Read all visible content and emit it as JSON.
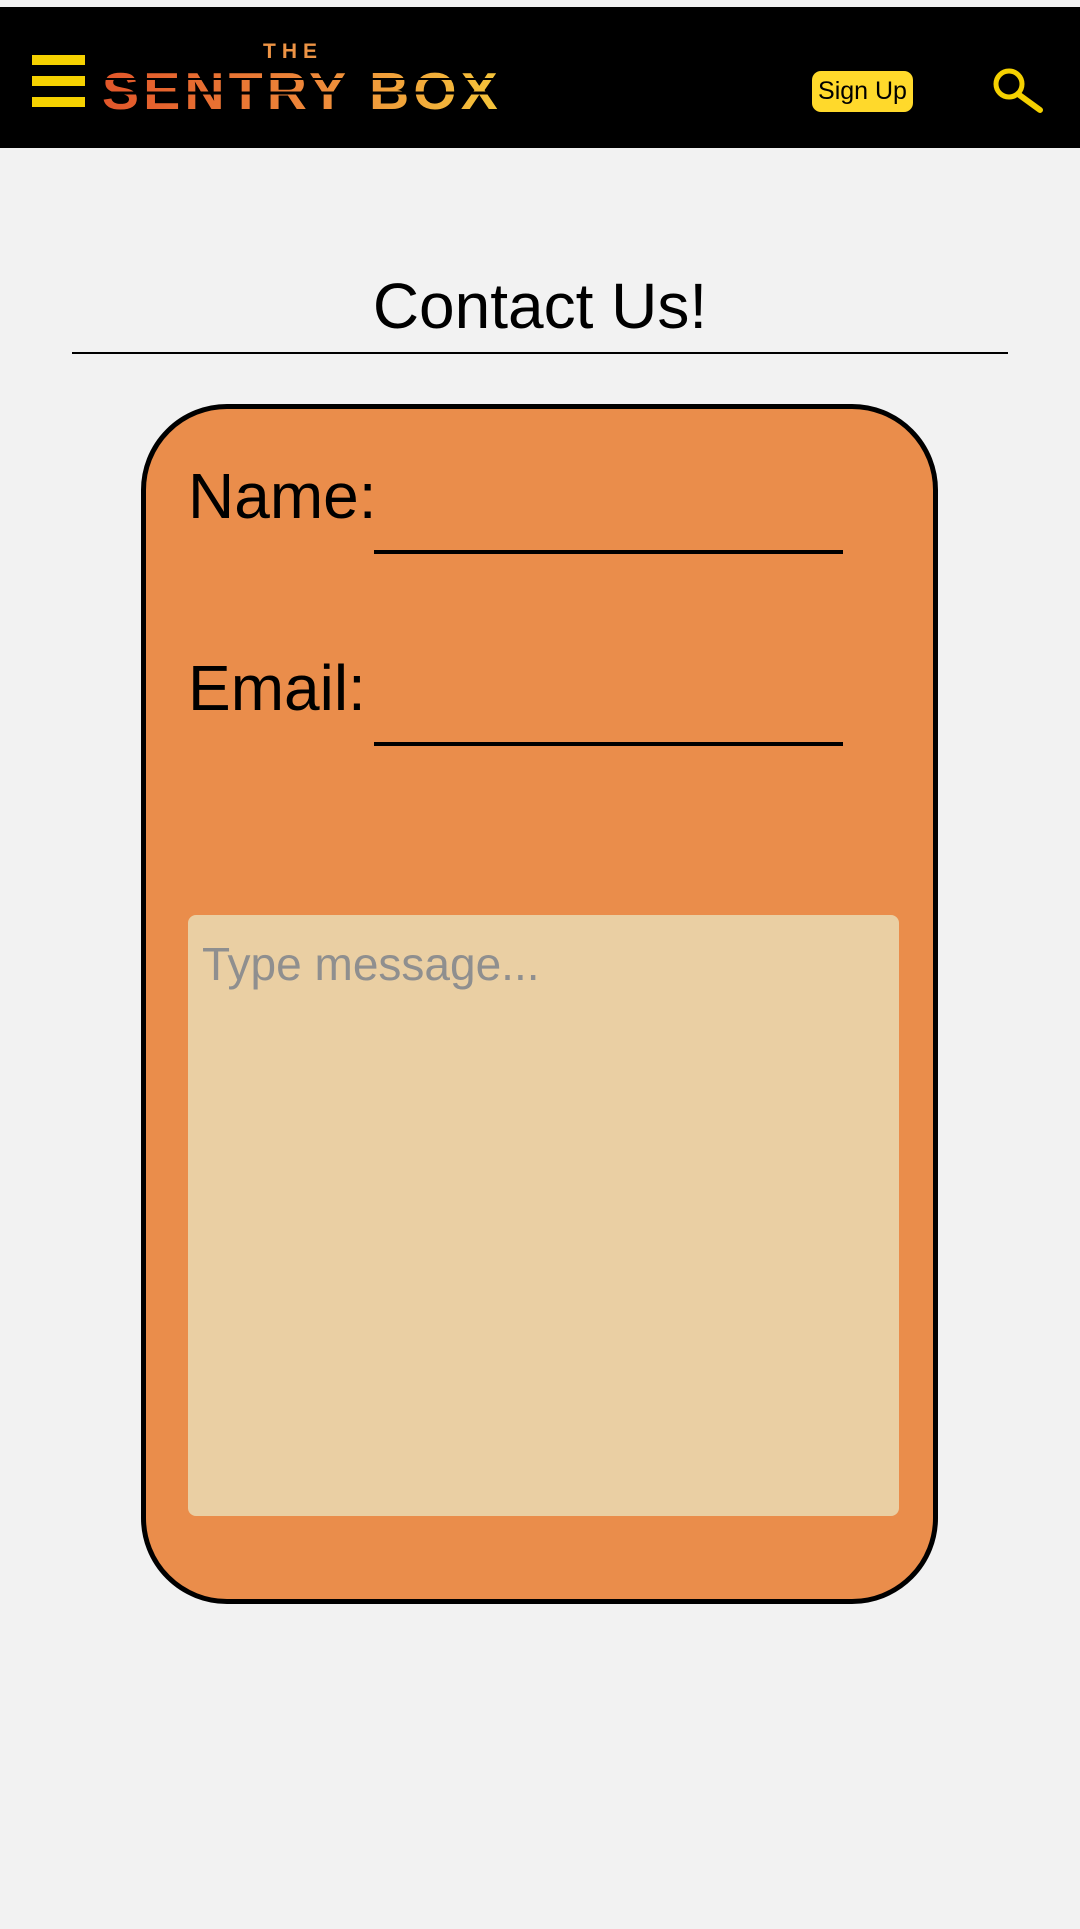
{
  "header": {
    "logo": {
      "small_word": "THE",
      "main_word": "SENTRY BOX",
      "gradient_colors": [
        "#e2562a",
        "#f2a44a",
        "#f5d100"
      ]
    },
    "menu_icon": "hamburger-menu-icon",
    "signup_label": "Sign Up",
    "search_icon": "search-icon",
    "background_color": "#000000",
    "accent_color": "#f5d100"
  },
  "page": {
    "title": "Contact Us!"
  },
  "form": {
    "name_label": "Name:",
    "name_value": "",
    "email_label": "Email:",
    "email_value": "",
    "message_placeholder": "Type message...",
    "message_value": "",
    "card_color": "#ea8d4b",
    "message_bg_color": "#eacfa3"
  }
}
